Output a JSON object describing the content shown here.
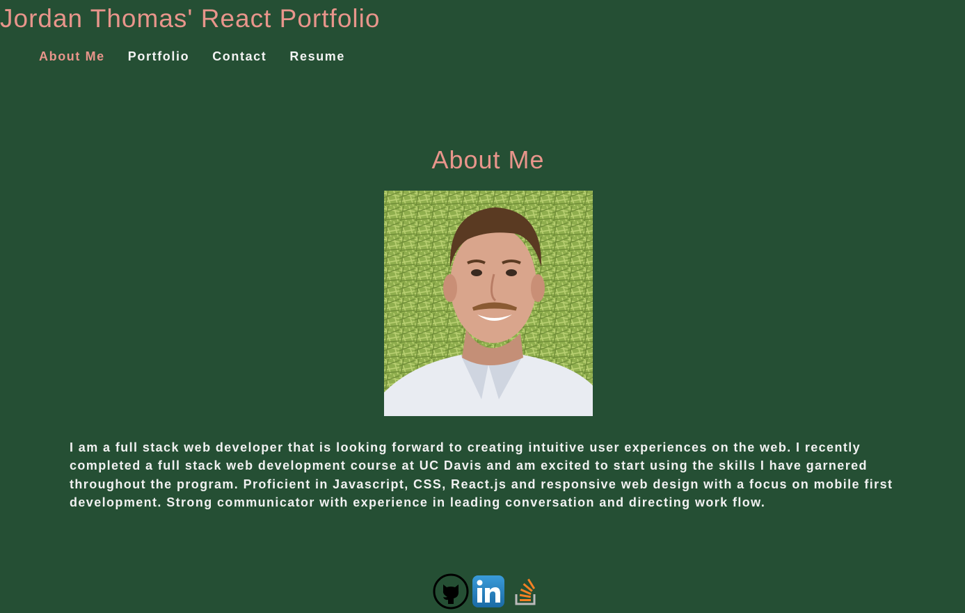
{
  "header": {
    "title": "Jordan Thomas' React Portfolio"
  },
  "nav": {
    "items": [
      {
        "label": "About Me",
        "active": true
      },
      {
        "label": "Portfolio",
        "active": false
      },
      {
        "label": "Contact",
        "active": false
      },
      {
        "label": "Resume",
        "active": false
      }
    ]
  },
  "about": {
    "heading": "About Me",
    "photo_icon": "profile-photo",
    "bio": "I am a full stack web developer that is looking forward to creating intuitive user experiences on the web. I recently completed a full stack web development course at UC Davis and am excited to start using the skills I have garnered throughout the program. Proficient in Javascript, CSS, React.js and responsive web design with a focus on mobile first development. Strong communicator with experience in leading conversation and directing work flow."
  },
  "footer": {
    "links": [
      {
        "icon": "github-icon"
      },
      {
        "icon": "linkedin-icon"
      },
      {
        "icon": "stackoverflow-icon"
      }
    ]
  },
  "colors": {
    "background": "#254f34",
    "accent": "#e8958b",
    "text": "#f1f1f1"
  }
}
